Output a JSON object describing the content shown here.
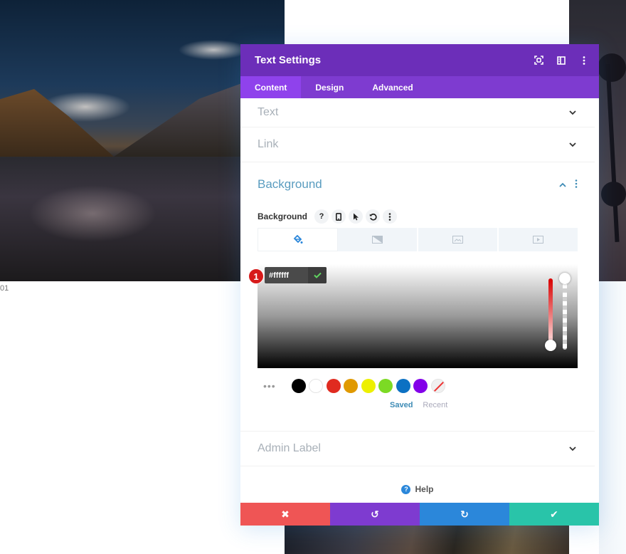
{
  "background": {
    "caption": "01"
  },
  "panel": {
    "title": "Text Settings",
    "header_icons": [
      "expand-icon",
      "split-view-icon",
      "kebab-menu-icon"
    ],
    "tabs": [
      {
        "label": "Content",
        "active": true
      },
      {
        "label": "Design",
        "active": false
      },
      {
        "label": "Advanced",
        "active": false
      }
    ],
    "sections": {
      "text": {
        "title": "Text",
        "open": false
      },
      "link": {
        "title": "Link",
        "open": false
      },
      "background": {
        "title": "Background",
        "open": true,
        "field_label": "Background",
        "field_icons": {
          "help": "?",
          "responsive": "▯",
          "hover": "➤",
          "reset": "↺",
          "more": "⋮"
        },
        "bg_type_tabs": [
          {
            "name": "color",
            "active": true
          },
          {
            "name": "gradient",
            "active": false
          },
          {
            "name": "image",
            "active": false
          },
          {
            "name": "video",
            "active": false
          }
        ],
        "color_picker": {
          "hex_value": "#ffffff",
          "badge_number": "1",
          "hue": "red",
          "hue_position": 1.0,
          "alpha": 1.0
        },
        "swatches": [
          "#000000",
          "#ffffff",
          "#e02b20",
          "#e09900",
          "#edf000",
          "#7cda24",
          "#0c71c3",
          "#8300e9",
          "none"
        ],
        "swatch_tabs": [
          {
            "label": "Saved",
            "active": true
          },
          {
            "label": "Recent",
            "active": false
          }
        ]
      },
      "admin_label": {
        "title": "Admin Label",
        "open": false
      }
    },
    "help_label": "Help",
    "footer": {
      "discard_icon": "✖",
      "undo_icon": "↺",
      "redo_icon": "↻",
      "save_icon": "✔"
    },
    "colors": {
      "header": "#6c2eb9",
      "tabs": "#7e3bd0",
      "active_tab": "#8f42ec",
      "discard": "#ef5555",
      "undo": "#7e3bd0",
      "redo": "#2b87da",
      "save": "#29c4a9"
    }
  }
}
